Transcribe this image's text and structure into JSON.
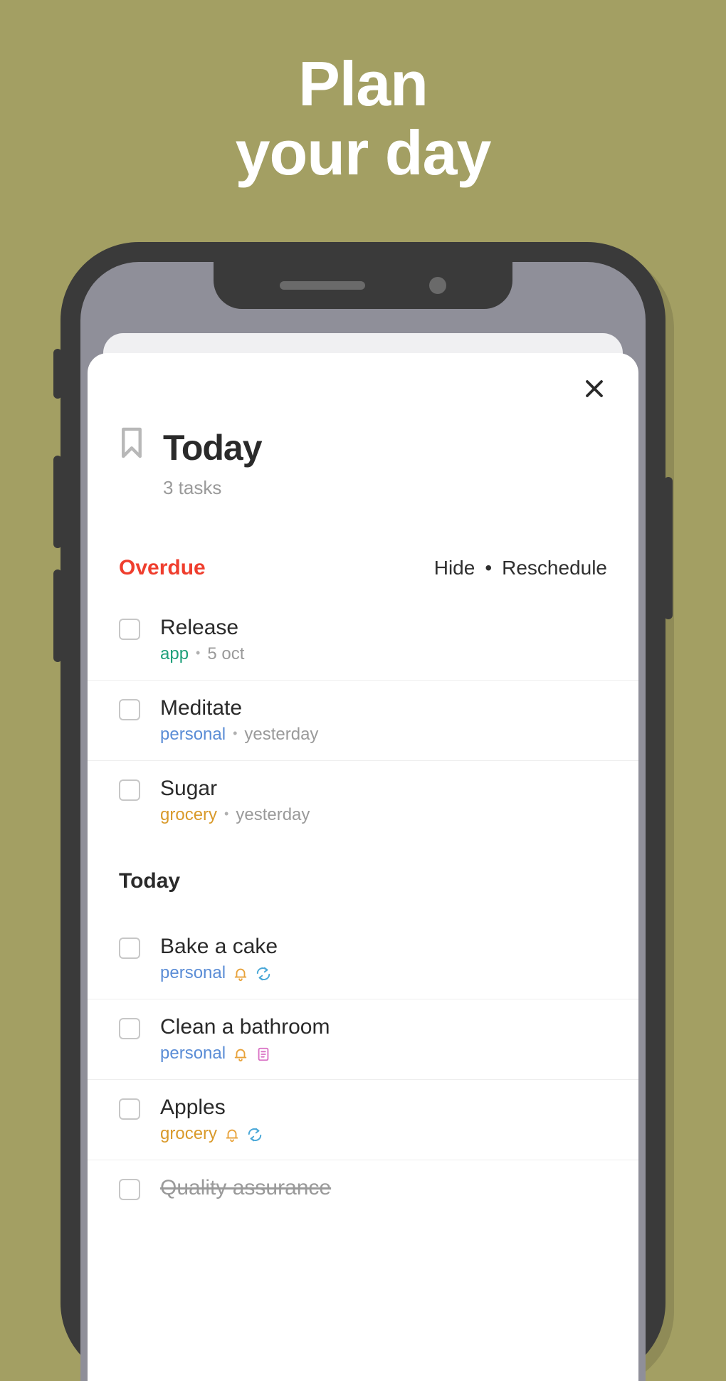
{
  "hero": {
    "line1": "Plan",
    "line2": "your day"
  },
  "sheet": {
    "title": "Today",
    "subtitle": "3 tasks",
    "close_label": "Close"
  },
  "sections": {
    "overdue": {
      "label": "Overdue",
      "hide": "Hide",
      "reschedule": "Reschedule"
    },
    "today": {
      "label": "Today"
    }
  },
  "tasks": {
    "overdue": [
      {
        "title": "Release",
        "tag": "app",
        "tag_class": "tag-app",
        "date": "5 oct"
      },
      {
        "title": "Meditate",
        "tag": "personal",
        "tag_class": "tag-personal",
        "date": "yesterday"
      },
      {
        "title": "Sugar",
        "tag": "grocery",
        "tag_class": "tag-grocery",
        "date": "yesterday"
      }
    ],
    "today": [
      {
        "title": "Bake a cake",
        "tag": "personal",
        "tag_class": "tag-personal",
        "icons": [
          "bell",
          "repeat"
        ]
      },
      {
        "title": "Clean a bathroom",
        "tag": "personal",
        "tag_class": "tag-personal",
        "icons": [
          "bell",
          "note"
        ]
      },
      {
        "title": "Apples",
        "tag": "grocery",
        "tag_class": "tag-grocery",
        "icons": [
          "bell",
          "repeat"
        ]
      },
      {
        "title": "Quality assurance",
        "tag": "",
        "tag_class": "",
        "icons": [],
        "completed": true
      }
    ]
  }
}
